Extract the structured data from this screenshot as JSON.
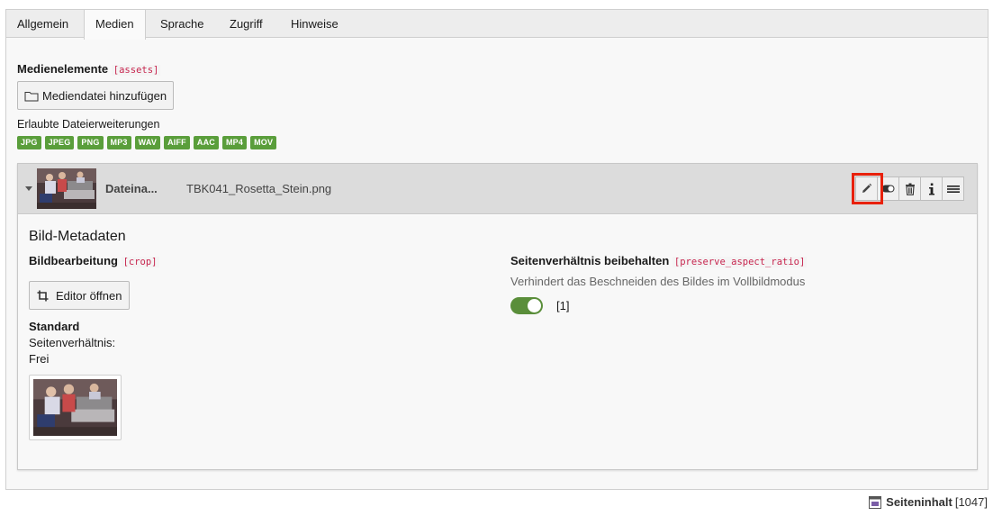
{
  "tabs": [
    {
      "label": "Allgemein",
      "active": false
    },
    {
      "label": "Medien",
      "active": true
    },
    {
      "label": "Sprache",
      "active": false
    },
    {
      "label": "Zugriff",
      "active": false
    },
    {
      "label": "Hinweise",
      "active": false
    }
  ],
  "assets": {
    "title": "Medienelemente",
    "field_name": "[assets]",
    "add_button_label": "Mediendatei hinzufügen",
    "add_button_icon": "folder-icon",
    "allowed_label": "Erlaubte Dateierweiterungen",
    "extensions": [
      "JPG",
      "JPEG",
      "PNG",
      "MP3",
      "WAV",
      "AIFF",
      "AAC",
      "MP4",
      "MOV"
    ],
    "badge_color": "#5a9e3b"
  },
  "file": {
    "filename_label": "Dateina...",
    "filename_value": "TBK041_Rosetta_Stein.png",
    "controls": [
      {
        "name": "edit",
        "icon": "pencil-icon",
        "highlighted": true
      },
      {
        "name": "toggle-visibility",
        "icon": "toggle-icon",
        "highlighted": false
      },
      {
        "name": "delete",
        "icon": "trash-icon",
        "highlighted": false
      },
      {
        "name": "info",
        "icon": "info-icon",
        "highlighted": false
      },
      {
        "name": "drag",
        "icon": "menu-icon",
        "highlighted": false
      }
    ],
    "highlight_color": "#e8210c"
  },
  "metadata": {
    "title": "Bild-Metadaten",
    "crop": {
      "title": "Bildbearbeitung",
      "field_name": "[crop]",
      "button_label": "Editor öffnen",
      "button_icon": "crop-icon",
      "standard_title": "Standard",
      "aspect_label": "Seitenverhältnis:",
      "aspect_value": "Frei"
    },
    "preserve": {
      "title": "Seitenverhältnis beibehalten",
      "field_name": "[preserve_aspect_ratio]",
      "description": "Verhindert das Beschneiden des Bildes im Vollbildmodus",
      "toggle_on": true,
      "toggle_label": "[1]",
      "toggle_color": "#5a8e3a"
    }
  },
  "footer": {
    "icon": "page-content-icon",
    "label": "Seiteninhalt",
    "id": "[1047]"
  }
}
